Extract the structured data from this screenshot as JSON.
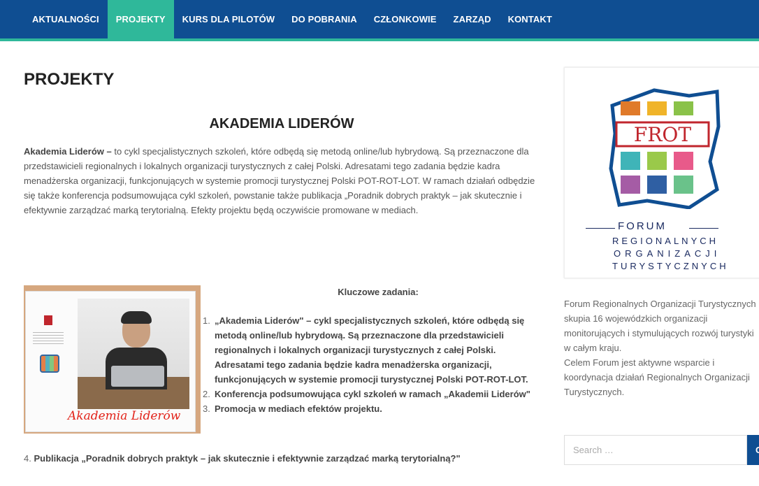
{
  "nav": {
    "items": [
      {
        "label": "AKTUALNOŚCI",
        "active": false
      },
      {
        "label": "PROJEKTY",
        "active": true
      },
      {
        "label": "KURS DLA PILOTÓW",
        "active": false
      },
      {
        "label": "DO POBRANIA",
        "active": false
      },
      {
        "label": "CZŁONKOWIE",
        "active": false
      },
      {
        "label": "ZARZĄD",
        "active": false
      },
      {
        "label": "KONTAKT",
        "active": false
      }
    ]
  },
  "main": {
    "page_title": "PROJEKTY",
    "section_title": "AKADEMIA LIDERÓW",
    "intro_bold": "Akademia Liderów –",
    "intro_text": " to cykl specjalistycznych szkoleń, które odbędą się metodą online/lub hybrydową.  Są przeznaczone dla przedstawicieli regionalnych i lokalnych organizacji turystycznych z całej Polski. Adresatami tego zadania będzie kadra menadżerska organizacji, funkcjonujących w systemie promocji turystycznej Polski POT-ROT-LOT. W ramach działań odbędzie się także konferencja podsumowująca cykl szkoleń, powstanie także publikacja „Poradnik dobrych praktyk – jak skutecznie i efektywnie zarządzać marką terytorialną. Efekty projektu będą oczywiście promowane w mediach.",
    "promo_logo": "Akademia Liderów",
    "tasks_heading": "Kluczowe zadania:",
    "tasks": [
      {
        "num": "1.",
        "text": "„Akademia Liderów\" – cykl specjalistycznych szkoleń, które odbędą się metodą online/lub hybrydową.  Są przeznaczone dla przedstawicieli regionalnych i lokalnych organizacji turystycznych z całej Polski. Adresatami tego zadania będzie kadra menadżerska organizacji, funkcjonujących w systemie promocji turystycznej Polski POT-ROT-LOT."
      },
      {
        "num": "2.",
        "text": "Konferencja podsumowująca cykl szkoleń w ramach „Akademii Liderów\""
      },
      {
        "num": "3.",
        "text": "Promocja w mediach efektów projektu."
      },
      {
        "num": "4.",
        "text": "Publikacja „Poradnik dobrych praktyk – jak skutecznie i efektywnie zarządzać marką terytorialną?\""
      }
    ]
  },
  "sidebar": {
    "logo": {
      "frot": "FROT",
      "forum": "FORUM",
      "line2": "REGIONALNYCH",
      "line3": "ORGANIZACJI",
      "line4": "TURYSTYCZNYCH"
    },
    "description_lines": [
      "Forum Regionalnych Organizacji Turystycznych",
      "skupia 16 wojewódzkich organizacji",
      "monitorujących i stymulujących rozwój turystyki",
      "w całym kraju.",
      "Celem Forum jest aktywne wsparcie i",
      "koordynacja działań Regionalnych Organizacji",
      "Turystycznych."
    ],
    "search": {
      "placeholder": "Search …",
      "button_label": "GO"
    }
  },
  "colors": {
    "nav_bg": "#0f4e92",
    "accent": "#2fb89a"
  }
}
